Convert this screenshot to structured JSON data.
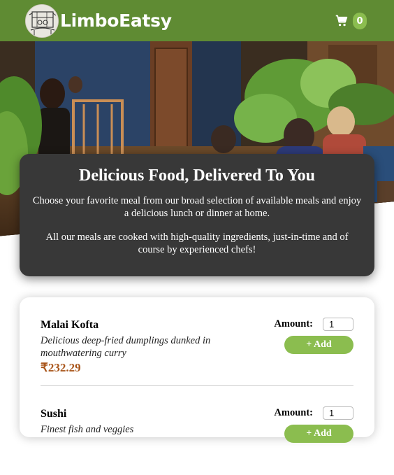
{
  "header": {
    "brand": "LimboEatsy",
    "cart_count": "0",
    "logo_icon": "restaurant-sketch-logo",
    "cart_icon": "shopping-cart-icon"
  },
  "summary": {
    "title": "Delicious Food, Delivered To You",
    "paragraph1": "Choose your favorite meal from our broad selection of available meals and enjoy a delicious lunch or dinner at home.",
    "paragraph2": "All our meals are cooked with high-quality ingredients, just-in-time and of course by experienced chefs!"
  },
  "meals": [
    {
      "name": "Malai Kofta",
      "description": "Delicious deep-fried dumplings dunked in mouthwatering curry",
      "price": "₹232.29",
      "amount_label": "Amount:",
      "amount_value": "1",
      "add_label": "+ Add"
    },
    {
      "name": "Sushi",
      "description": "Finest fish and veggies",
      "price": "",
      "amount_label": "Amount:",
      "amount_value": "1",
      "add_label": "+ Add"
    }
  ],
  "colors": {
    "header": "#5f8b33",
    "accent": "#8bbd4f",
    "summary_bg": "#383838",
    "price": "#a9561b"
  }
}
